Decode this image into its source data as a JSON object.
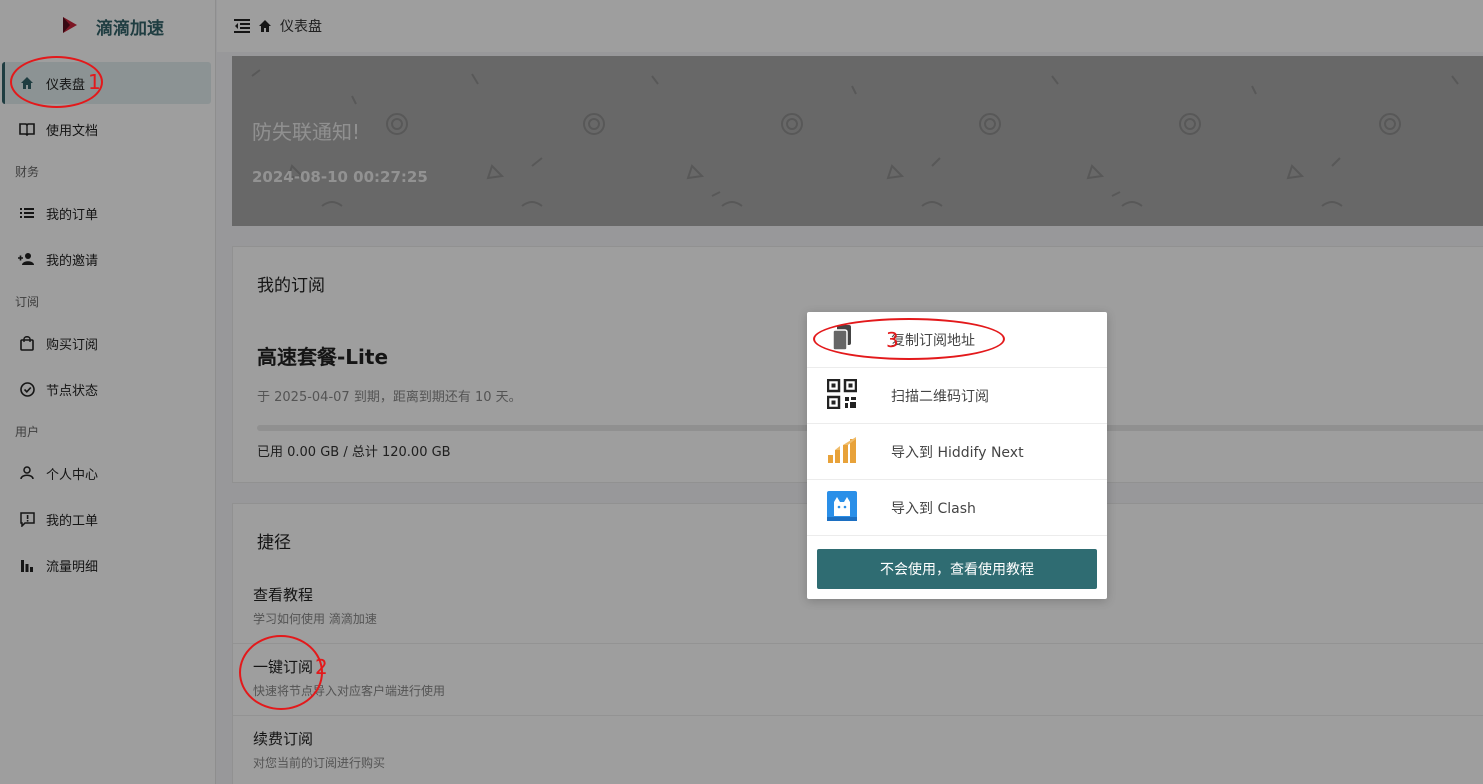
{
  "brand": {
    "name": "滴滴加速"
  },
  "sidebar": {
    "items": [
      {
        "label": "仪表盘",
        "icon": "home-icon",
        "active": true
      },
      {
        "label": "使用文档",
        "icon": "book-icon"
      }
    ],
    "groups": [
      {
        "title": "财务",
        "items": [
          {
            "label": "我的订单",
            "icon": "list-icon"
          },
          {
            "label": "我的邀请",
            "icon": "user-plus-icon"
          }
        ]
      },
      {
        "title": "订阅",
        "items": [
          {
            "label": "购买订阅",
            "icon": "bag-icon"
          },
          {
            "label": "节点状态",
            "icon": "check-circle-icon"
          }
        ]
      },
      {
        "title": "用户",
        "items": [
          {
            "label": "个人中心",
            "icon": "user-icon"
          },
          {
            "label": "我的工单",
            "icon": "ticket-icon"
          },
          {
            "label": "流量明细",
            "icon": "bar-chart-icon"
          }
        ]
      }
    ]
  },
  "header": {
    "breadcrumb": "仪表盘"
  },
  "banner": {
    "title": "防失联通知!",
    "time": "2024-08-10 00:27:25"
  },
  "subscription": {
    "title": "我的订阅",
    "plan": "高速套餐-Lite",
    "expire": "于 2025-04-07 到期，距离到期还有 10 天。",
    "usage": "已用 0.00 GB / 总计 120.00 GB",
    "usage_fraction": 0.0
  },
  "shortcuts": {
    "title": "捷径",
    "items": [
      {
        "title": "查看教程",
        "desc": "学习如何使用 滴滴加速"
      },
      {
        "title": "一键订阅",
        "desc": "快速将节点导入对应客户端进行使用"
      },
      {
        "title": "续费订阅",
        "desc": "对您当前的订阅进行购买"
      }
    ]
  },
  "popup": {
    "items": [
      {
        "label": "复制订阅地址",
        "icon": "copy-icon"
      },
      {
        "label": "扫描二维码订阅",
        "icon": "qrcode-icon"
      },
      {
        "label": "导入到 Hiddify Next",
        "icon": "hiddify-icon"
      },
      {
        "label": "导入到 Clash",
        "icon": "clash-cat-icon"
      }
    ],
    "button": "不会使用，查看使用教程"
  },
  "annotations": [
    "1",
    "2",
    "3"
  ],
  "colors": {
    "accent": "#2f6c72",
    "annotation": "#e3191b"
  }
}
